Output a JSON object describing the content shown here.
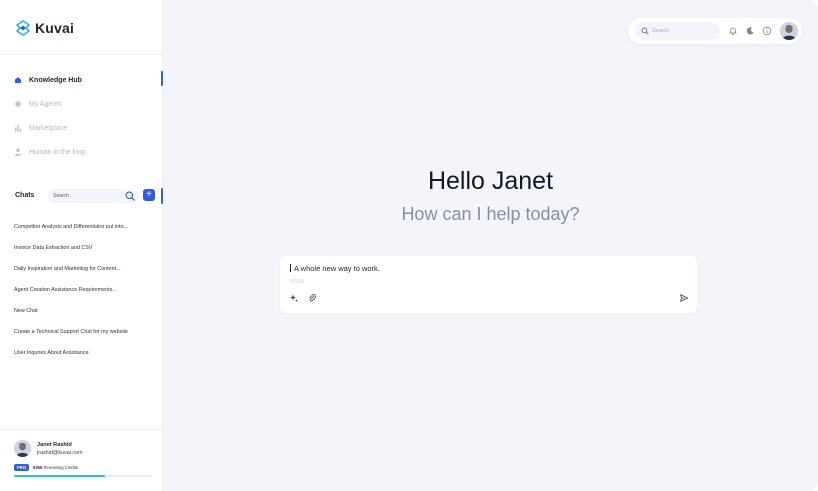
{
  "brand": {
    "name": "Kuvai",
    "accent": "#2f5de8",
    "logo_color": "#2bb4e0"
  },
  "nav": {
    "items": [
      {
        "label": "Knowledge Hub",
        "icon": "home-icon",
        "active": true
      },
      {
        "label": "My Agents",
        "icon": "agent-icon",
        "active": false
      },
      {
        "label": "Marketplace",
        "icon": "bar-chart-icon",
        "active": false
      },
      {
        "label": "Human in the loop",
        "icon": "person-icon",
        "active": false
      }
    ]
  },
  "chats": {
    "title": "Chats",
    "search_placeholder": "Search",
    "items": [
      "Competitor Analysis and Differentiator put into...",
      "Invoice Data Extraction and CSV",
      "Daily Inspiration and Marketing for Content...",
      "Agent Creation Assistance Requirements...",
      "New Chat",
      "Create a Technical Support Chat for my website",
      "User Inquires About Assistance"
    ]
  },
  "profile": {
    "name": "Janet Rashid",
    "email": "jrashid@kuvai.com",
    "plan": "PRO",
    "credits_value": "9356",
    "credits_label": "Remaining Credits",
    "credits_fraction": 0.66
  },
  "topbar": {
    "search_placeholder": "Search",
    "icons": [
      "bell-icon",
      "moon-icon",
      "info-icon"
    ]
  },
  "main": {
    "greeting": "Hello Janet",
    "subgreeting": "How can I help today?"
  },
  "composer": {
    "text": "A whole new way to work.",
    "counter": "0/500"
  }
}
